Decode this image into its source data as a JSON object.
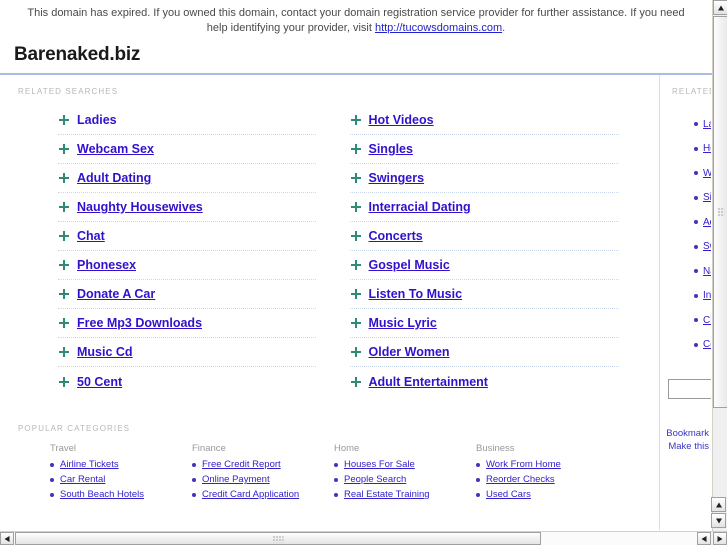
{
  "banner": {
    "text_before": "This domain has expired. If you owned this domain, contact your domain registration service provider for further assistance. If you need help identifying your provider, visit ",
    "link_text": "http://tucowsdomains.com",
    "text_after": "."
  },
  "header": {
    "domain_title": "Barenaked.biz"
  },
  "sections": {
    "related_searches_label": "RELATED SEARCHES",
    "popular_categories_label": "POPULAR CATEGORIES",
    "sidebar_related_label": "RELATED"
  },
  "related_searches": {
    "left": [
      {
        "label": "Ladies",
        "underlined": false
      },
      {
        "label": "Webcam Sex",
        "underlined": true
      },
      {
        "label": "Adult Dating",
        "underlined": true
      },
      {
        "label": "Naughty Housewives",
        "underlined": true
      },
      {
        "label": "Chat",
        "underlined": true
      },
      {
        "label": "Phonesex",
        "underlined": true
      },
      {
        "label": "Donate A Car",
        "underlined": true
      },
      {
        "label": "Free Mp3 Downloads",
        "underlined": true
      },
      {
        "label": "Music Cd",
        "underlined": true
      },
      {
        "label": "50 Cent",
        "underlined": true
      }
    ],
    "right": [
      {
        "label": "Hot Videos",
        "underlined": true
      },
      {
        "label": "Singles",
        "underlined": true
      },
      {
        "label": "Swingers",
        "underlined": true
      },
      {
        "label": "Interracial Dating",
        "underlined": true
      },
      {
        "label": "Concerts",
        "underlined": true
      },
      {
        "label": "Gospel Music",
        "underlined": true
      },
      {
        "label": "Listen To Music",
        "underlined": true
      },
      {
        "label": "Music Lyric",
        "underlined": true
      },
      {
        "label": "Older Women",
        "underlined": true
      },
      {
        "label": "Adult Entertainment",
        "underlined": true
      }
    ]
  },
  "popular_categories": [
    {
      "heading": "Travel",
      "links": [
        "Airline Tickets",
        "Car Rental",
        "South Beach Hotels"
      ]
    },
    {
      "heading": "Finance",
      "links": [
        "Free Credit Report",
        "Online Payment",
        "Credit Card Application"
      ]
    },
    {
      "heading": "Home",
      "links": [
        "Houses For Sale",
        "People Search",
        "Real Estate Training"
      ]
    },
    {
      "heading": "Business",
      "links": [
        "Work From Home",
        "Reorder Checks",
        "Used Cars"
      ]
    }
  ],
  "sidebar": {
    "items": [
      "Ladies",
      "Hot Videos",
      "Webcam Sex",
      "Singles",
      "Adult Dating",
      "Swingers",
      "Naughty Housewives",
      "Interracial Dating",
      "Chat",
      "Concerts"
    ],
    "search_value": "",
    "search_placeholder": "",
    "footer_links": [
      "Bookmark",
      "Make this"
    ]
  },
  "colors": {
    "link": "#3311cc",
    "bullet_green": "#2e8b78",
    "rule": "#aabbe4",
    "label_gray": "#b8b8b8"
  },
  "scrollbars": {
    "v_up": "▲",
    "v_down": "▼",
    "h_left": "◀",
    "h_right": "▶"
  }
}
